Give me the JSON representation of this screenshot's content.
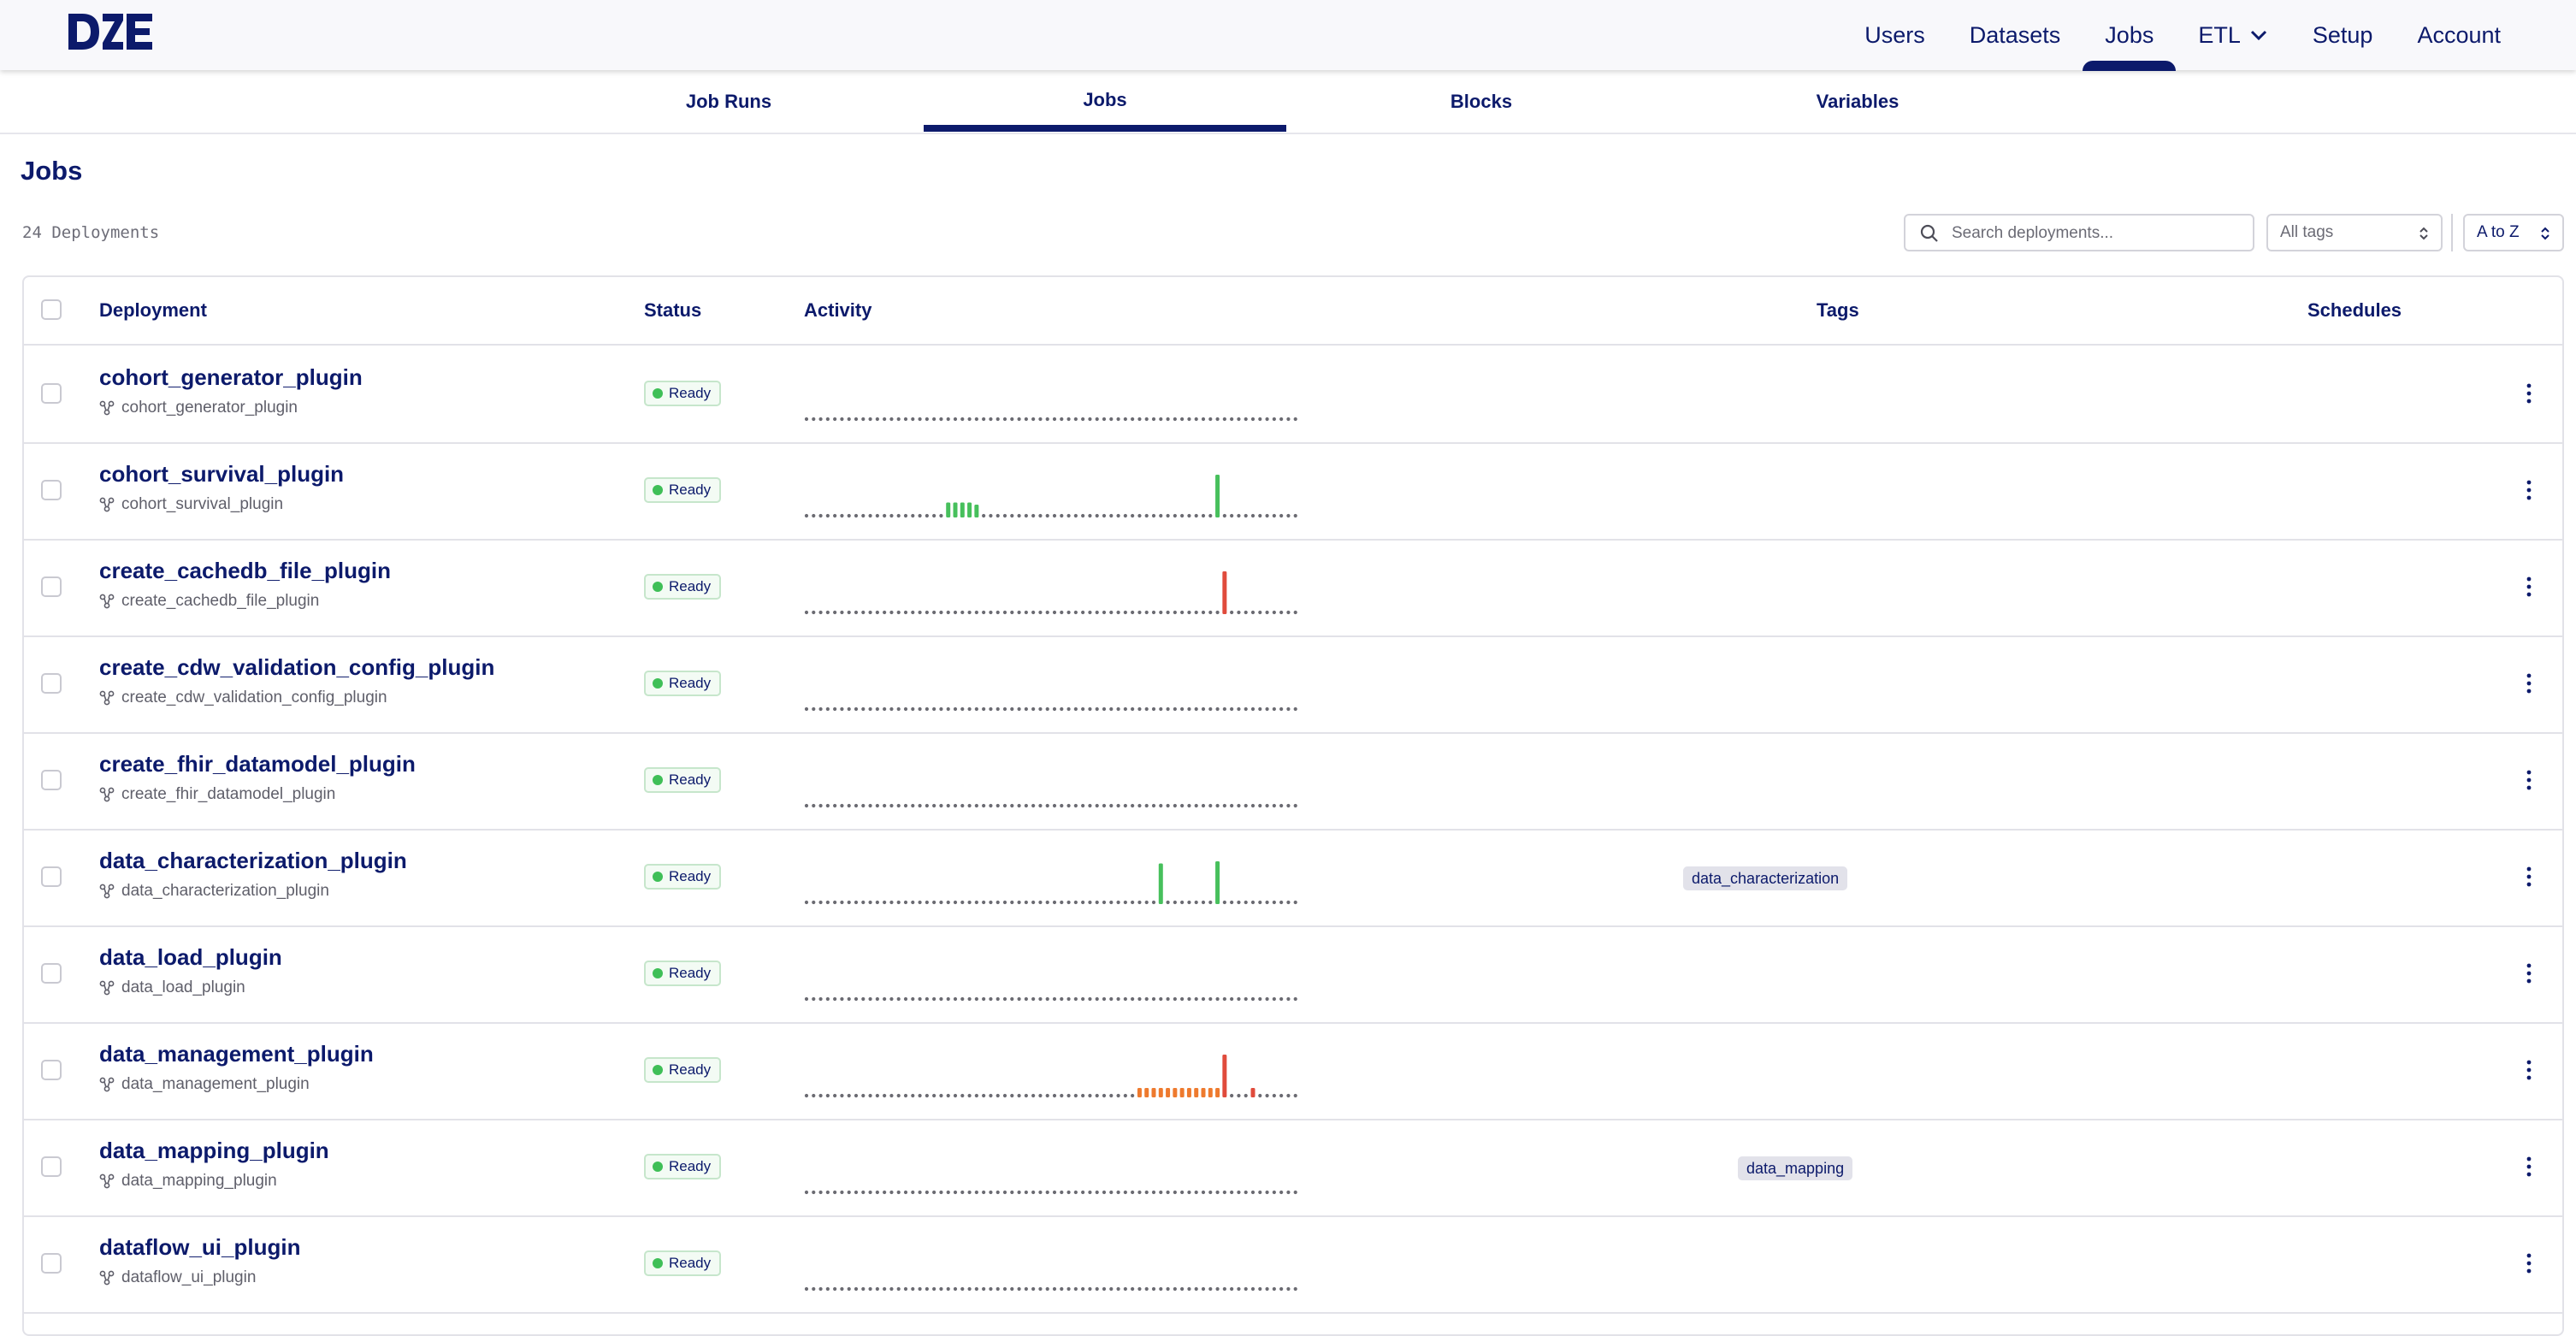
{
  "app": {
    "logo_text": "D2E",
    "nav": [
      {
        "label": "Users",
        "active": false
      },
      {
        "label": "Datasets",
        "active": false
      },
      {
        "label": "Jobs",
        "active": true
      },
      {
        "label": "ETL",
        "active": false,
        "has_dropdown": true
      },
      {
        "label": "Setup",
        "active": false
      },
      {
        "label": "Account",
        "active": false
      }
    ],
    "accent_color": "#0c1a6b"
  },
  "tabs": [
    {
      "label": "Job Runs",
      "active": false
    },
    {
      "label": "Jobs",
      "active": true
    },
    {
      "label": "Blocks",
      "active": false
    },
    {
      "label": "Variables",
      "active": false
    }
  ],
  "page": {
    "title": "Jobs",
    "count_label": "24 Deployments"
  },
  "filters": {
    "search_placeholder": "Search deployments...",
    "search_value": "",
    "tags_select": "All tags",
    "sort_select": "A to Z"
  },
  "table": {
    "columns": [
      "Deployment",
      "Status",
      "Activity",
      "Tags",
      "Schedules"
    ],
    "rows": [
      {
        "name": "cohort_generator_plugin",
        "flow": "cohort_generator_plugin",
        "status": "Ready",
        "tags": [],
        "activity": []
      },
      {
        "name": "cohort_survival_plugin",
        "flow": "cohort_survival_plugin",
        "status": "Ready",
        "tags": [],
        "activity": [
          {
            "i": 20,
            "h": 0.35,
            "state": "completed"
          },
          {
            "i": 21,
            "h": 0.35,
            "state": "completed"
          },
          {
            "i": 22,
            "h": 0.35,
            "state": "completed"
          },
          {
            "i": 23,
            "h": 0.35,
            "state": "completed"
          },
          {
            "i": 24,
            "h": 0.3,
            "state": "completed"
          },
          {
            "i": 58,
            "h": 1.0,
            "state": "completed"
          }
        ]
      },
      {
        "name": "create_cachedb_file_plugin",
        "flow": "create_cachedb_file_plugin",
        "status": "Ready",
        "tags": [],
        "activity": [
          {
            "i": 59,
            "h": 1.0,
            "state": "failed"
          }
        ]
      },
      {
        "name": "create_cdw_validation_config_plugin",
        "flow": "create_cdw_validation_config_plugin",
        "status": "Ready",
        "tags": [],
        "activity": []
      },
      {
        "name": "create_fhir_datamodel_plugin",
        "flow": "create_fhir_datamodel_plugin",
        "status": "Ready",
        "tags": [],
        "activity": []
      },
      {
        "name": "data_characterization_plugin",
        "flow": "data_characterization_plugin",
        "status": "Ready",
        "tags": [
          "data_characterization"
        ],
        "activity": [
          {
            "i": 50,
            "h": 0.95,
            "state": "completed"
          },
          {
            "i": 58,
            "h": 1.0,
            "state": "completed"
          }
        ]
      },
      {
        "name": "data_load_plugin",
        "flow": "data_load_plugin",
        "status": "Ready",
        "tags": [],
        "activity": []
      },
      {
        "name": "data_management_plugin",
        "flow": "data_management_plugin",
        "status": "Ready",
        "tags": [],
        "activity": [
          {
            "i": 47,
            "h": 0.22,
            "state": "crashed"
          },
          {
            "i": 48,
            "h": 0.22,
            "state": "crashed"
          },
          {
            "i": 49,
            "h": 0.22,
            "state": "crashed"
          },
          {
            "i": 50,
            "h": 0.22,
            "state": "crashed"
          },
          {
            "i": 51,
            "h": 0.22,
            "state": "crashed"
          },
          {
            "i": 52,
            "h": 0.22,
            "state": "crashed"
          },
          {
            "i": 53,
            "h": 0.22,
            "state": "crashed"
          },
          {
            "i": 54,
            "h": 0.22,
            "state": "crashed"
          },
          {
            "i": 55,
            "h": 0.22,
            "state": "crashed"
          },
          {
            "i": 56,
            "h": 0.22,
            "state": "crashed"
          },
          {
            "i": 57,
            "h": 0.22,
            "state": "crashed"
          },
          {
            "i": 58,
            "h": 0.22,
            "state": "crashed"
          },
          {
            "i": 59,
            "h": 1.0,
            "state": "failed"
          },
          {
            "i": 63,
            "h": 0.22,
            "state": "failed"
          }
        ]
      },
      {
        "name": "data_mapping_plugin",
        "flow": "data_mapping_plugin",
        "status": "Ready",
        "tags": [
          "data_mapping"
        ],
        "activity": []
      },
      {
        "name": "dataflow_ui_plugin",
        "flow": "dataflow_ui_plugin",
        "status": "Ready",
        "tags": [],
        "activity": []
      }
    ]
  },
  "colors": {
    "completed": "#47c05c",
    "failed": "#e04b3c",
    "crashed": "#ee7a2e",
    "idle_dot": "#6b6b72"
  },
  "icons": {
    "search": "search-icon",
    "flow": "flow-icon",
    "kebab": "more-vertical-icon",
    "updown": "chevron-updown-icon",
    "chevron": "chevron-down-icon"
  }
}
